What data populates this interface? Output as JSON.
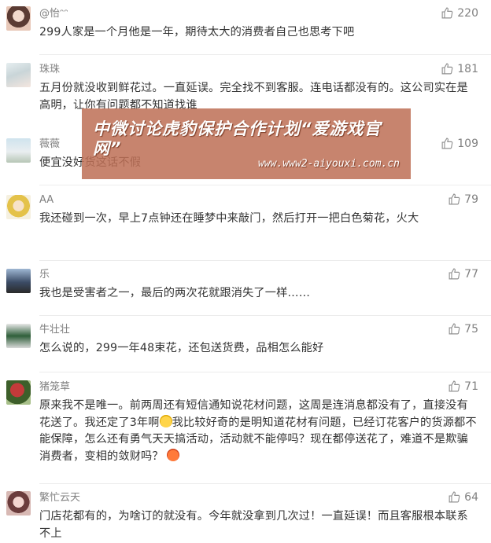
{
  "comments": [
    {
      "user": "@怡ᵔᵔ",
      "likes": "220",
      "text": "299人家是一个月他是一年，期待太大的消费者自己也思考下吧"
    },
    {
      "user": "珠珠",
      "likes": "181",
      "text": "五月份就没收到鲜花过。一直延误。完全找不到客服。连电话都没有的。这公司实在是高明，让你有问题都不知道找谁"
    },
    {
      "user": "薇薇",
      "likes": "109",
      "text": "便宜没好货这话不假"
    },
    {
      "user": "AA",
      "likes": "79",
      "text": "我还碰到一次，早上7点钟还在睡梦中来敲门，然后打开一把白色菊花，火大"
    },
    {
      "user": "乐",
      "likes": "77",
      "text": "我也是受害者之一，最后的两次花就跟消失了一样……"
    },
    {
      "user": "牛壮壮",
      "likes": "75",
      "text": "怎么说的，299一年48束花，还包送货费，品相怎么能好"
    },
    {
      "user": "猪笼草",
      "likes": "71",
      "text_a": "原来我不是唯一。前两周还有短信通知说花材问题，这周是连消息都没有了，直接没有花送了。我还定了3年啊",
      "text_b": "我比较好奇的是明知道花材有问题，已经订花客户的货源都不能保障，怎么还有勇气天天搞活动，活动就不能停吗？现在都停送花了，难道不是欺骗消费者，变相的敛财吗？"
    },
    {
      "user": "繁忙云天",
      "likes": "64",
      "text": "门店花都有的，为啥订的就没有。今年就没拿到几次过！一直延误！而且客服根本联系不上"
    }
  ],
  "watermark": {
    "title": "中微讨论虎豹保护合作计划“爱游戏官网”",
    "url": "www.www2-aiyouxi.com.cn"
  },
  "colors": {
    "like_icon": "#909090",
    "text": "#333333",
    "meta": "#808080",
    "watermark_bg": "#be7056"
  }
}
